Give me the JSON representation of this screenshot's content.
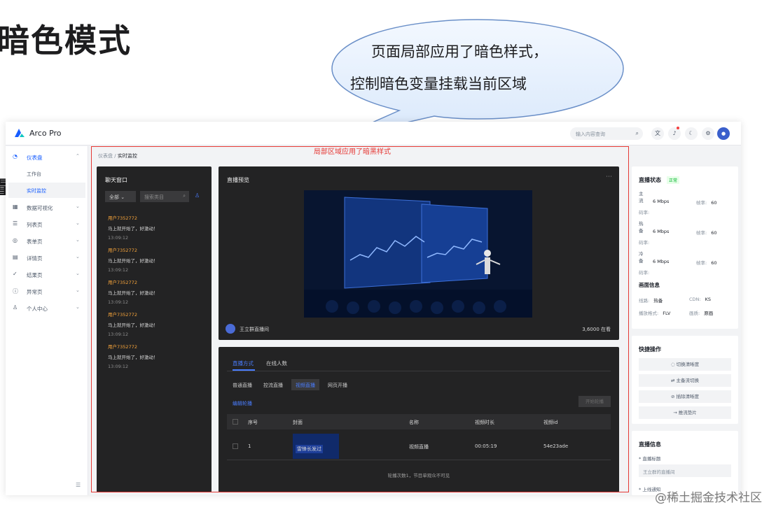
{
  "slide": {
    "title": "暗色模式",
    "side_fragment": "量，",
    "bubble_line1": "页面局部应用了暗色样式，",
    "bubble_line2": "控制暗色变量挂载当前区域",
    "red_label": "局部区域应用了暗黑样式",
    "watermark": "@稀土掘金技术社区"
  },
  "app": {
    "name": "Arco Pro",
    "search_placeholder": "输入内容查询",
    "topbar_icons": [
      "language-icon",
      "bell-icon",
      "moon-icon",
      "settings-icon"
    ]
  },
  "sidebar": {
    "items": [
      {
        "label": "仪表盘",
        "icon": "dashboard-icon",
        "active": true
      },
      {
        "label": "数据可视化",
        "icon": "chart-icon"
      },
      {
        "label": "列表页",
        "icon": "list-icon"
      },
      {
        "label": "表单页",
        "icon": "form-icon"
      },
      {
        "label": "详情页",
        "icon": "detail-icon"
      },
      {
        "label": "结果页",
        "icon": "result-icon"
      },
      {
        "label": "异常页",
        "icon": "exception-icon"
      },
      {
        "label": "个人中心",
        "icon": "user-icon"
      }
    ],
    "sub_items": [
      "工作台",
      "实时监控"
    ]
  },
  "breadcrumb": [
    "仪表盘",
    "实时监控"
  ],
  "chat": {
    "title": "聊天窗口",
    "filter": "全部",
    "search_placeholder": "搜索类目",
    "messages": [
      {
        "user": "用户7352772",
        "text": "马上就开始了，好激动！",
        "time": "13:09:12"
      },
      {
        "user": "用户7352772",
        "text": "马上就开始了，好激动！",
        "time": "13:09:12"
      },
      {
        "user": "用户7352772",
        "text": "马上就开始了，好激动！",
        "time": "13:09:12"
      },
      {
        "user": "用户7352772",
        "text": "马上就开始了，好激动！",
        "time": "13:09:12"
      },
      {
        "user": "用户7352772",
        "text": "马上就开始了，好激动！",
        "time": "13:09:12"
      }
    ]
  },
  "preview": {
    "title": "直播预览",
    "anchor": "王立群直播间",
    "viewers": "3,6000 在看"
  },
  "settings": {
    "tabs": [
      "直播方式",
      "在线人数"
    ],
    "modes": [
      "普通直播",
      "控流直播",
      "视频直播",
      "网页开播"
    ],
    "active_mode": 2,
    "edit_link": "编辑轮播",
    "start_btn": "开始轮播",
    "columns": [
      "序号",
      "封面",
      "名称",
      "视频时长",
      "视频id"
    ],
    "rows": [
      {
        "index": "1",
        "cover_tag": "雷锋长发过",
        "name": "视频直播",
        "duration": "00:05:19",
        "id": "54e23ade"
      }
    ],
    "footer": "轮播次数1，节目单观众不可见"
  },
  "status": {
    "title": "直播状态",
    "badge": "正常",
    "streams": [
      {
        "name": "主流",
        "bitrate": "6 Mbps",
        "fps_label": "帧率:",
        "fps": "60",
        "rate_label": "码率:"
      },
      {
        "name": "热备",
        "bitrate": "6 Mbps",
        "fps_label": "帧率:",
        "fps": "60",
        "rate_label": "码率:"
      },
      {
        "name": "冷备",
        "bitrate": "6 Mbps",
        "fps_label": "帧率:",
        "fps": "60",
        "rate_label": "码率:"
      }
    ],
    "info_title": "画面信息",
    "line_label": "线路:",
    "line_value": "热备",
    "cdn_label": "CDN:",
    "cdn_value": "KS",
    "format_label": "播放格式:",
    "format_value": "FLV",
    "quality_label": "画质:",
    "quality_value": "原画"
  },
  "quick": {
    "title": "快捷操作",
    "buttons": [
      "切换清晰度",
      "主备流切换",
      "插除清晰度",
      "推流垫片"
    ]
  },
  "liveinfo": {
    "title": "直播信息",
    "field_label": "直播标题",
    "field_value": "王立群的直播间",
    "next_label": "上线通知"
  }
}
